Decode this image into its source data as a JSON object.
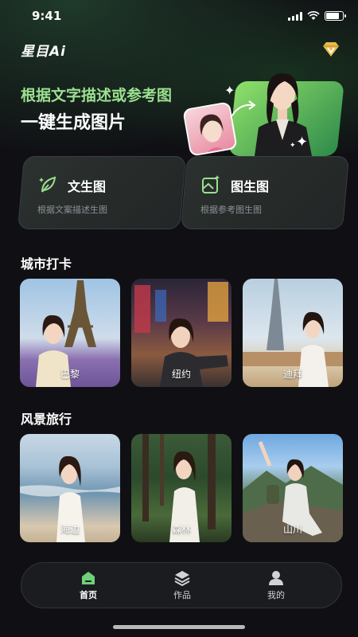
{
  "status_bar": {
    "time": "9:41",
    "battery_level": 0.85
  },
  "header": {
    "app_name": "星目Ai",
    "vip_icon": "diamond-v-icon"
  },
  "hero": {
    "line1": "根据文字描述或参考图",
    "line2": "一键生成图片"
  },
  "features": [
    {
      "title": "文生图",
      "subtitle": "根据文案描述生图",
      "icon": "leaf-pen-icon"
    },
    {
      "title": "图生图",
      "subtitle": "根据参考图生图",
      "icon": "image-sparkle-icon"
    }
  ],
  "sections": {
    "city": {
      "title": "城市打卡",
      "items": [
        {
          "label": "巴黎"
        },
        {
          "label": "纽约"
        },
        {
          "label": "迪拜"
        }
      ]
    },
    "scenery": {
      "title": "风景旅行",
      "items": [
        {
          "label": "海边"
        },
        {
          "label": "森林"
        },
        {
          "label": "山川"
        }
      ]
    }
  },
  "tab_bar": {
    "tabs": [
      {
        "label": "首页",
        "icon": "home-icon",
        "active": true
      },
      {
        "label": "作品",
        "icon": "layers-icon",
        "active": false
      },
      {
        "label": "我的",
        "icon": "user-icon",
        "active": false
      }
    ]
  },
  "colors": {
    "accent": "#9be08f",
    "background": "#101014",
    "card": "#262a2e"
  }
}
